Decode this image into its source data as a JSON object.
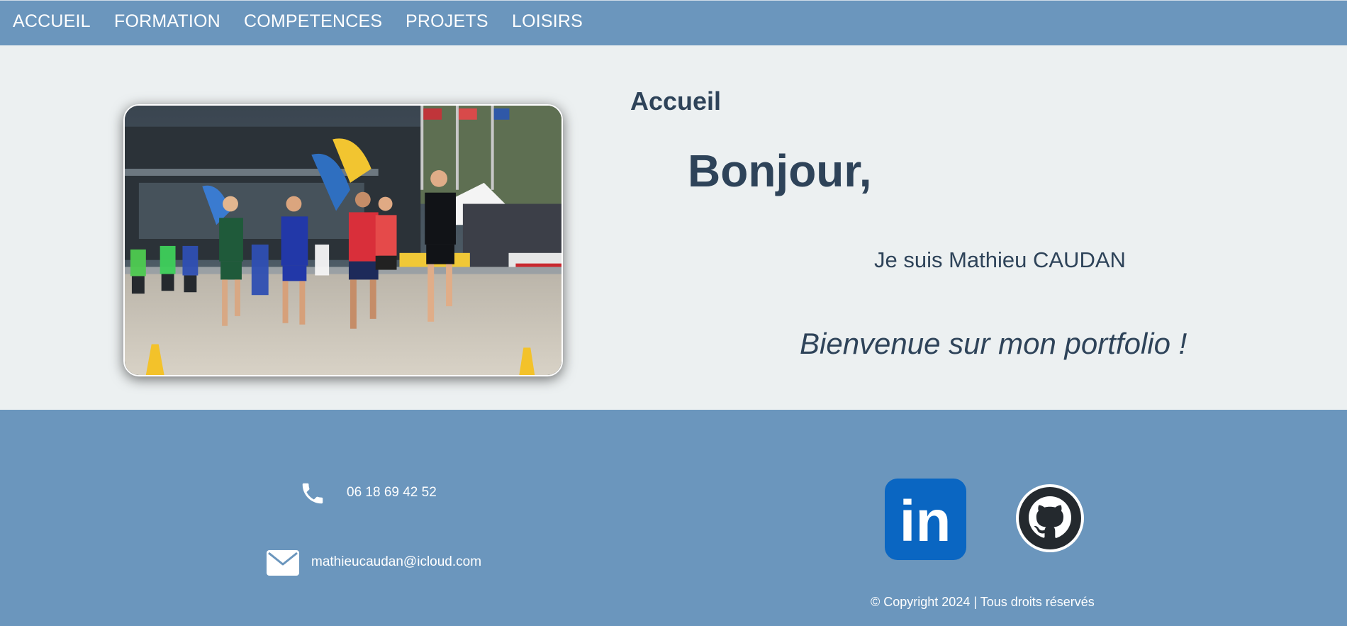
{
  "nav": {
    "items": [
      {
        "label": "ACCUEIL"
      },
      {
        "label": "FORMATION"
      },
      {
        "label": "COMPETENCES"
      },
      {
        "label": "PROJETS"
      },
      {
        "label": "LOISIRS"
      }
    ]
  },
  "hero": {
    "section_title": "Accueil",
    "greeting": "Bonjour,",
    "intro": "Je suis Mathieu CAUDAN",
    "welcome": "Bienvenue sur mon portfolio !",
    "photo_icon": "runners-race-photo"
  },
  "footer": {
    "phone": {
      "icon": "phone-icon",
      "text": "06 18 69 42 52"
    },
    "email": {
      "icon": "envelope-icon",
      "text": "mathieucaudan@icloud.com"
    },
    "social": [
      {
        "name": "linkedin",
        "icon": "linkedin-icon",
        "label": "in"
      },
      {
        "name": "github",
        "icon": "github-icon"
      }
    ],
    "copyright": "© Copyright 2024 | Tous droits réservés"
  },
  "colors": {
    "bar": "#6b96bd",
    "background": "#ecf0f1",
    "text": "#2e4359",
    "linkedin": "#0a66c2",
    "github": "#24292e"
  }
}
